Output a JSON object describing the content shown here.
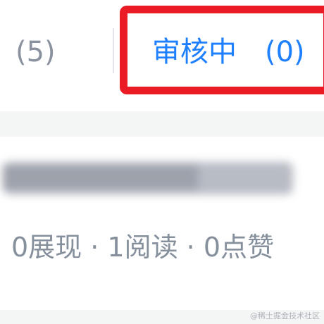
{
  "tabs": {
    "previous_count": "(5)",
    "active_label": "审核中",
    "active_count": "(0)"
  },
  "article": {
    "title_blurred": "████████████",
    "stats": "0展现 · 1阅读 · 0点赞"
  },
  "watermark": "@稀土掘金技术社区",
  "colors": {
    "active_tab": "#1e80ff",
    "highlight": "#ea1b24",
    "muted_text": "#86909c"
  }
}
